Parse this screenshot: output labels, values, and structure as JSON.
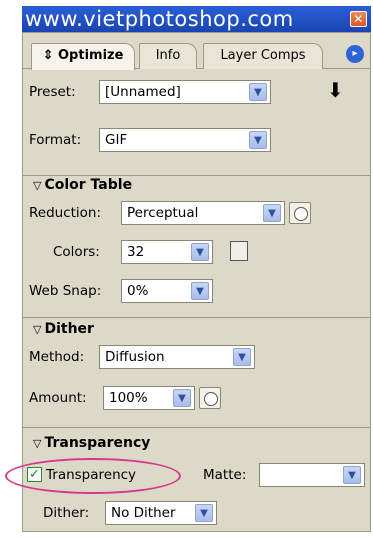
{
  "titlebar": {
    "watermark": "www.vietphotoshop.com",
    "close_glyph": "✕"
  },
  "tabs": [
    {
      "label": "Optimize",
      "active": true,
      "prefix": "⇕"
    },
    {
      "label": "Info",
      "active": false
    },
    {
      "label": "Layer Comps",
      "active": false
    }
  ],
  "panel_menu_glyph": "▸",
  "settings": {
    "preset_label": "Preset:",
    "preset_value": "[Unnamed]",
    "format_label": "Format:",
    "format_value": "GIF"
  },
  "color_table": {
    "heading": "Color Table",
    "reduction_label": "Reduction:",
    "reduction_value": "Perceptual",
    "colors_label": "Colors:",
    "colors_value": "32",
    "websnap_label": "Web Snap:",
    "websnap_value": "0%"
  },
  "dither": {
    "heading": "Dither",
    "method_label": "Method:",
    "method_value": "Diffusion",
    "amount_label": "Amount:",
    "amount_value": "100%"
  },
  "transparency": {
    "heading": "Transparency",
    "checkbox_label": "Transparency",
    "checked": true,
    "check_glyph": "✓",
    "matte_label": "Matte:",
    "matte_value": "",
    "dither_label": "Dither:",
    "dither_value": "No Dither"
  },
  "glyphs": {
    "dropdown_arrow": "▼",
    "section_triangle": "▽"
  },
  "colors": {
    "title_bar": "#1a44b3",
    "panel_bg": "#ddd9c8",
    "highlight_ellipse": "#d8388b"
  }
}
